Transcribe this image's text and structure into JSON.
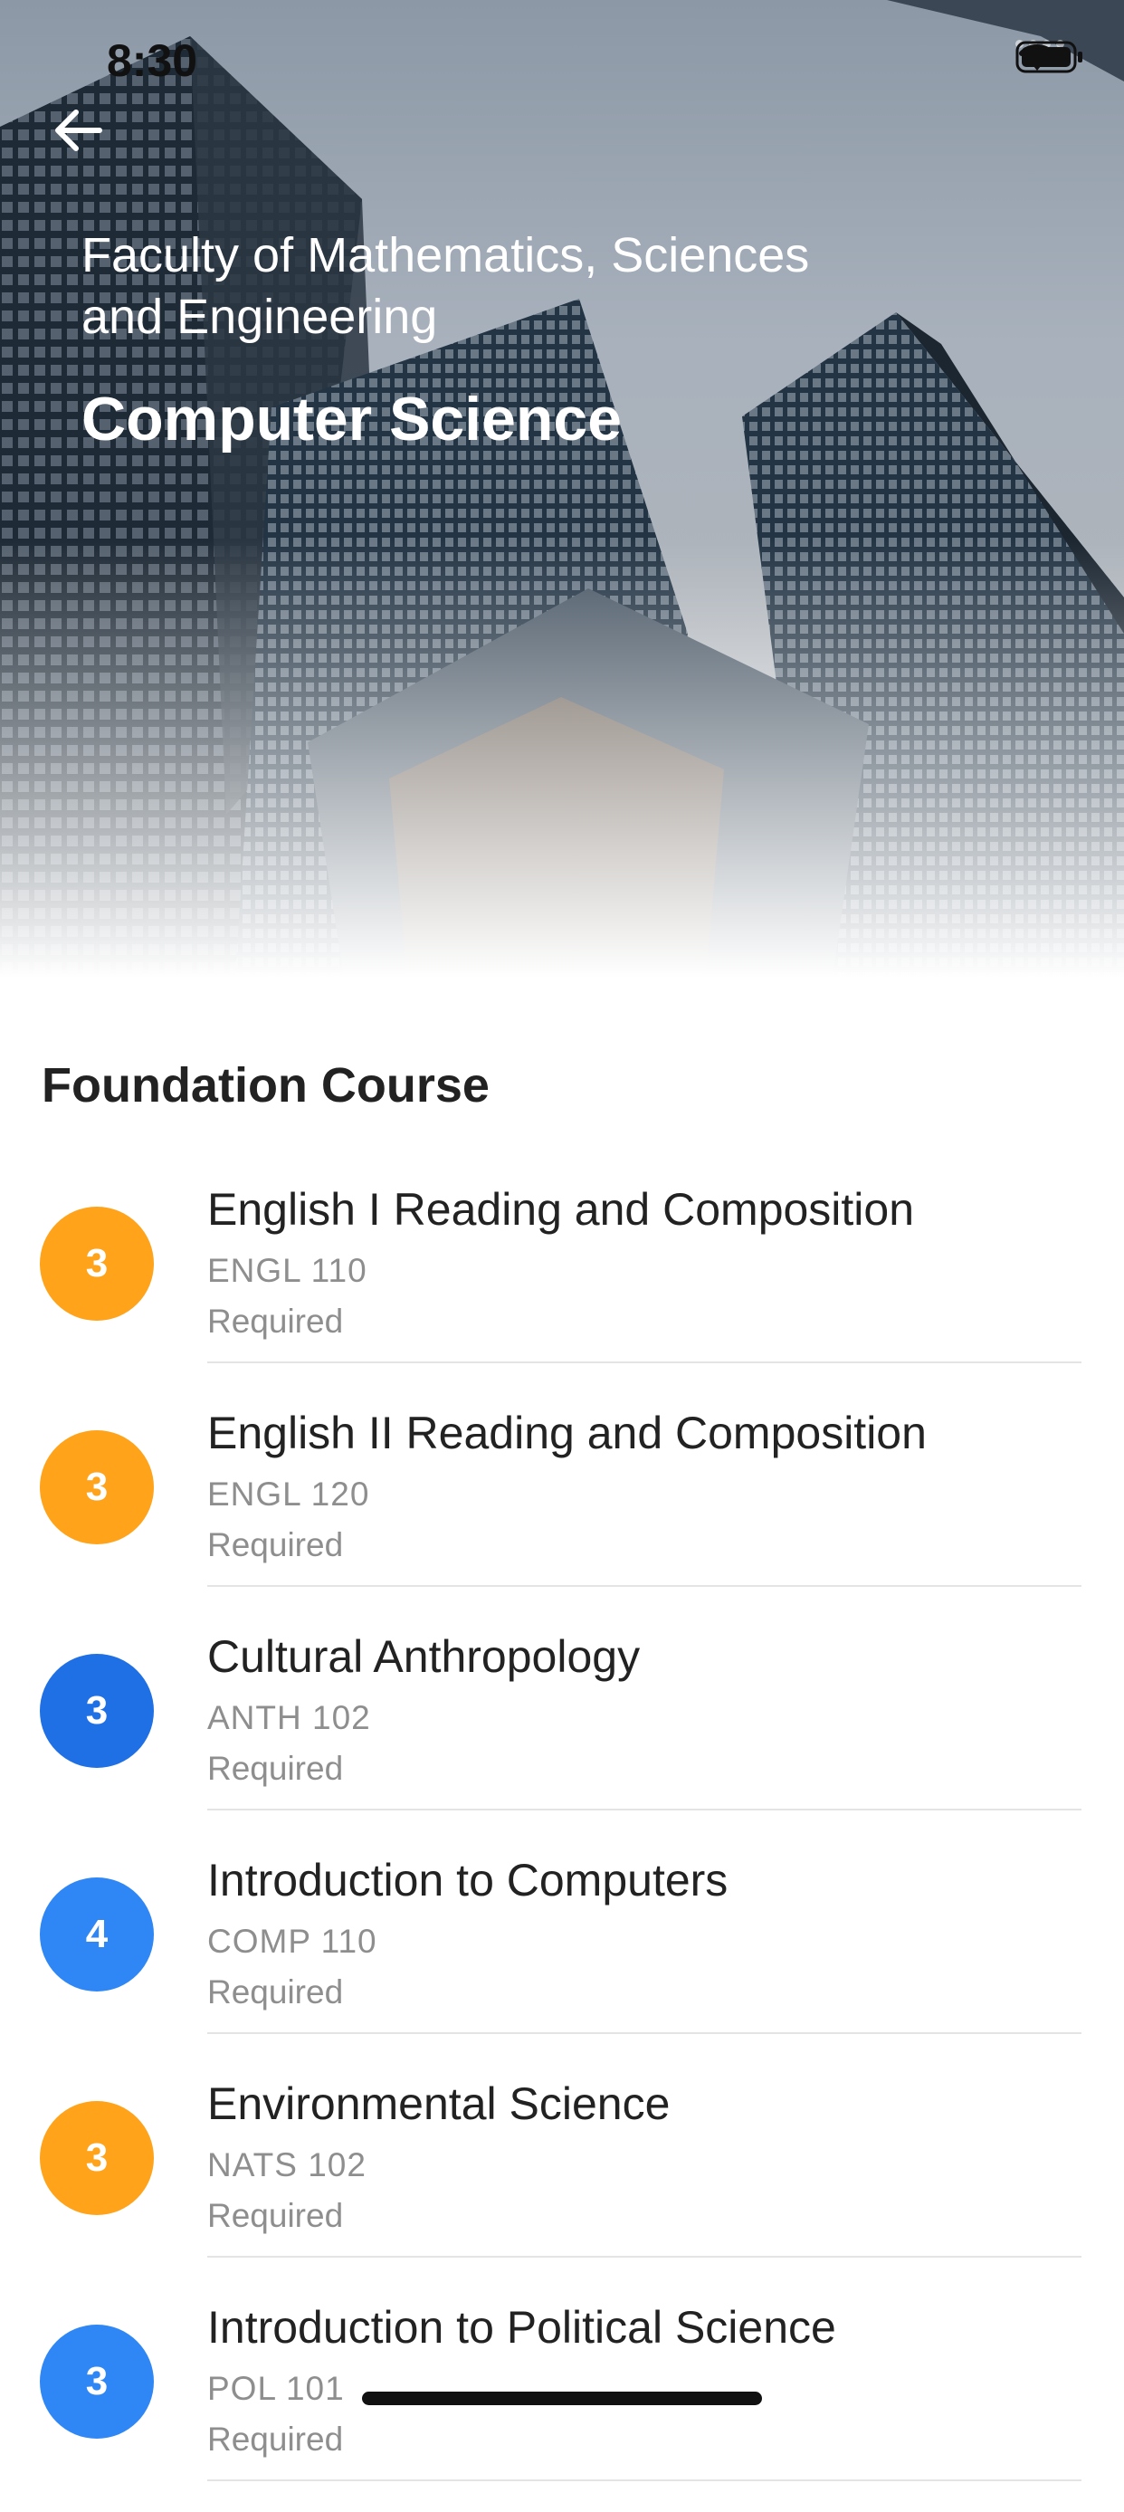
{
  "status_bar": {
    "time": "8:30",
    "signal_icon": "signal-dots-icon",
    "wifi_icon": "wifi-icon",
    "battery_icon": "battery-icon"
  },
  "header": {
    "back_icon": "arrow-left-icon",
    "faculty": "Faculty of Mathematics, Sciences and Engineering",
    "program": "Computer Science"
  },
  "section": {
    "title": "Foundation Course"
  },
  "courses": [
    {
      "credits": "3",
      "name": "English I Reading and Composition",
      "code": "ENGL 110",
      "status": "Required",
      "color": "#FFA31A"
    },
    {
      "credits": "3",
      "name": "English II Reading and Composition",
      "code": "ENGL 120",
      "status": "Required",
      "color": "#FFA31A"
    },
    {
      "credits": "3",
      "name": "Cultural Anthropology",
      "code": "ANTH 102",
      "status": "Required",
      "color": "#1F6FE5"
    },
    {
      "credits": "4",
      "name": "Introduction to Computers",
      "code": "COMP 110",
      "status": "Required",
      "color": "#2F86F5"
    },
    {
      "credits": "3",
      "name": "Environmental Science",
      "code": "NATS 102",
      "status": "Required",
      "color": "#FFA31A"
    },
    {
      "credits": "3",
      "name": "Introduction to Political Science",
      "code": "POL 101",
      "status": "Required",
      "color": "#2F86F5"
    }
  ]
}
